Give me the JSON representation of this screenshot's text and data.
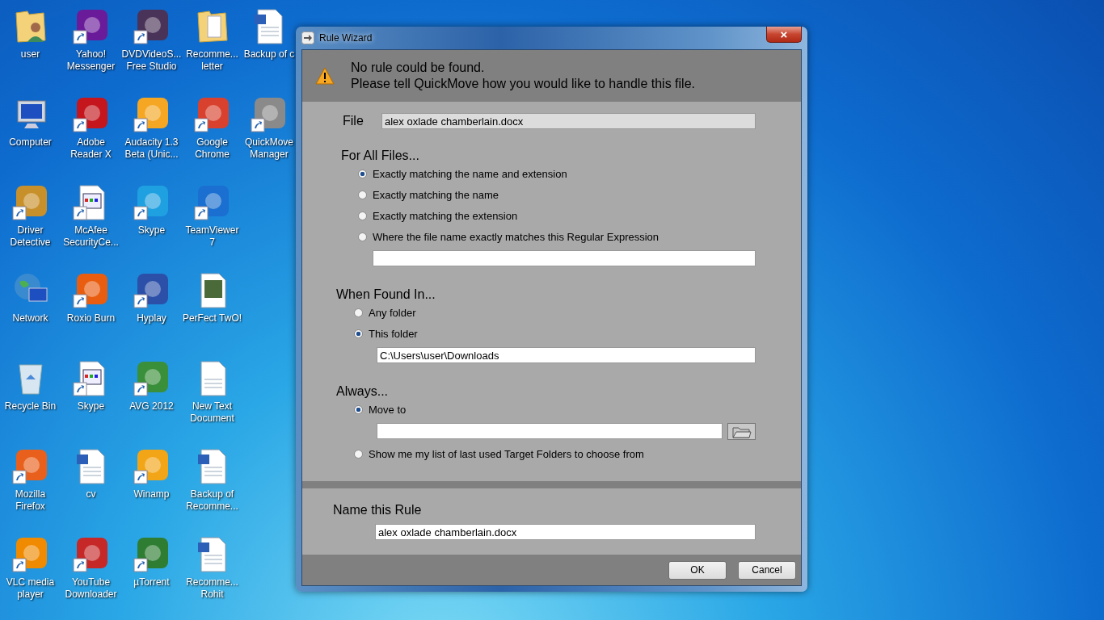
{
  "desktop": {
    "columns": [
      [
        {
          "label": "user",
          "kind": "user-folder",
          "shortcut": false
        },
        {
          "label": "Computer",
          "kind": "computer",
          "shortcut": false
        },
        {
          "label": "Driver\nDetective",
          "kind": "app",
          "color": "#c8902a",
          "shortcut": true
        },
        {
          "label": "Network",
          "kind": "network",
          "shortcut": false
        },
        {
          "label": "Recycle Bin",
          "kind": "recycle-bin",
          "shortcut": false
        },
        {
          "label": "Mozilla\nFirefox",
          "kind": "app",
          "color": "#e8601c",
          "shortcut": true
        },
        {
          "label": "VLC media\nplayer",
          "kind": "app",
          "color": "#f08a00",
          "shortcut": true
        }
      ],
      [
        {
          "label": "Yahoo!\nMessenger",
          "kind": "app",
          "color": "#6a1b9a",
          "shortcut": true
        },
        {
          "label": "Adobe\nReader X",
          "kind": "app",
          "color": "#c4161c",
          "shortcut": true
        },
        {
          "label": "McAfee\nSecurityCe...",
          "kind": "document",
          "shortcut": true
        },
        {
          "label": "Roxio Burn",
          "kind": "app",
          "color": "#e85d10",
          "shortcut": true
        },
        {
          "label": "Skype",
          "kind": "document",
          "shortcut": true
        },
        {
          "label": "cv",
          "kind": "word-document",
          "shortcut": false
        },
        {
          "label": "YouTube\nDownloader",
          "kind": "app",
          "color": "#c62828",
          "shortcut": true
        }
      ],
      [
        {
          "label": "DVDVideoS...\nFree Studio",
          "kind": "app",
          "color": "#4a3358",
          "shortcut": true
        },
        {
          "label": "Audacity 1.3\nBeta (Unic...",
          "kind": "app",
          "color": "#f5a623",
          "shortcut": true
        },
        {
          "label": "Skype",
          "kind": "app",
          "color": "#1fa0e0",
          "shortcut": true
        },
        {
          "label": "Hyplay",
          "kind": "app",
          "color": "#2c4fa8",
          "shortcut": true
        },
        {
          "label": "AVG 2012",
          "kind": "app",
          "color": "#3a8f3a",
          "shortcut": true
        },
        {
          "label": "Winamp",
          "kind": "app",
          "color": "#f2a516",
          "shortcut": true
        },
        {
          "label": "µTorrent",
          "kind": "app",
          "color": "#2e7d32",
          "shortcut": true
        }
      ],
      [
        {
          "label": "Recomme...\nletter",
          "kind": "folder",
          "shortcut": false
        },
        {
          "label": "Google\nChrome",
          "kind": "app",
          "color": "#d9412f",
          "shortcut": true
        },
        {
          "label": "TeamViewer\n7",
          "kind": "app",
          "color": "#1a6fd0",
          "shortcut": true
        },
        {
          "label": "PerFect TwO!",
          "kind": "video-file",
          "shortcut": false
        },
        {
          "label": "New Text\nDocument",
          "kind": "text-document",
          "shortcut": false
        },
        {
          "label": "Backup of\nRecomme...",
          "kind": "word-document",
          "shortcut": false
        },
        {
          "label": "Recomme...\nRohit",
          "kind": "word-document",
          "shortcut": false
        }
      ],
      [
        {
          "label": "Backup of c",
          "kind": "word-document",
          "shortcut": false
        },
        {
          "label": "QuickMove\nManager",
          "kind": "app",
          "color": "#8a8a8a",
          "shortcut": true
        }
      ]
    ]
  },
  "window": {
    "title": "Rule Wizard",
    "close": "×"
  },
  "header": {
    "lines": [
      "No rule could be found.",
      "Please tell QuickMove how you would like to handle this file."
    ]
  },
  "file": {
    "label": "File",
    "value": "alex oxlade chamberlain.docx"
  },
  "for_all_files": {
    "heading": "For All Files...",
    "options": [
      {
        "label": "Exactly matching the name and extension",
        "selected": true
      },
      {
        "label": "Exactly matching the name",
        "selected": false
      },
      {
        "label": "Exactly matching the extension",
        "selected": false
      },
      {
        "label": "Where the file name exactly matches this Regular Expression",
        "selected": false
      }
    ]
  },
  "when_found_in": {
    "heading": "When Found In...",
    "options": [
      {
        "label": "Any folder",
        "selected": false
      },
      {
        "label": "This folder",
        "selected": true
      }
    ],
    "path": "C:\\Users\\user\\Downloads"
  },
  "always": {
    "heading": "Always...",
    "options": [
      {
        "label": "Move to",
        "selected": true,
        "kind": "target-field"
      },
      {
        "label": "Show me my list of last used Target Folders to choose from",
        "selected": false,
        "kind": "plain"
      }
    ]
  },
  "name_rule": {
    "label": "Name this Rule",
    "value": "alex oxlade chamberlain.docx"
  },
  "buttons": [
    "OK",
    "Cancel"
  ]
}
